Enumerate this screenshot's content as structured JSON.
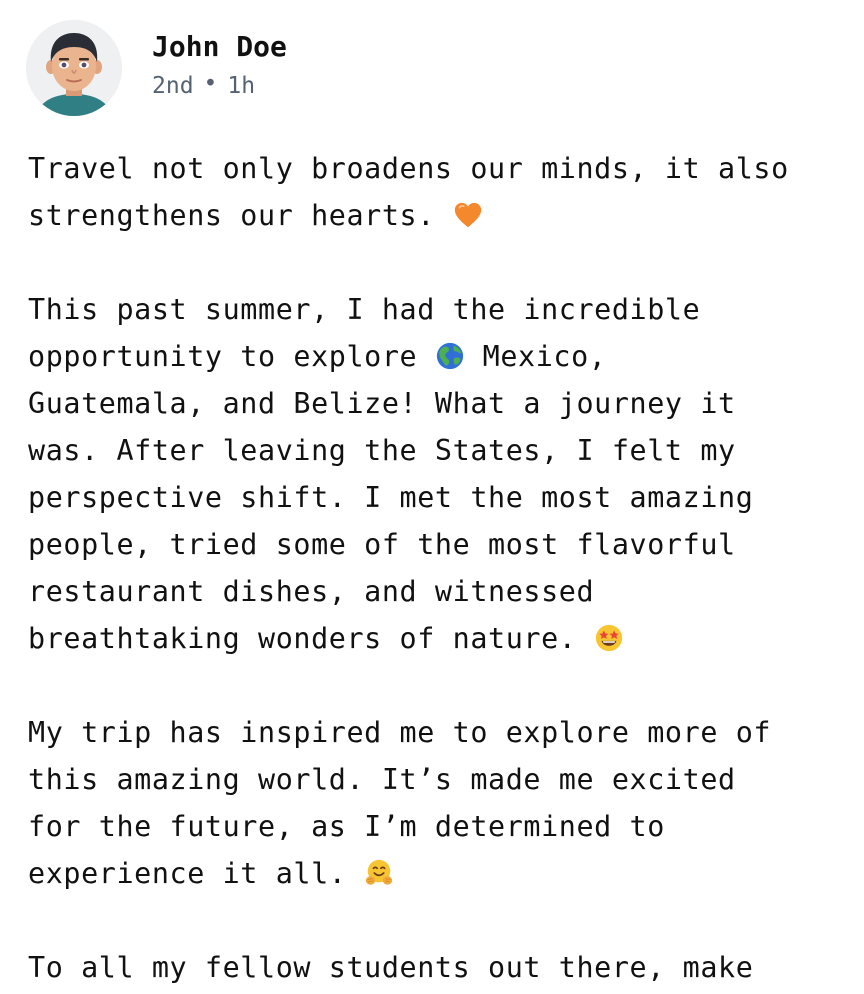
{
  "post": {
    "author": {
      "name": "John Doe",
      "avatar_icon": "man-avatar-icon",
      "connection_degree": "2nd",
      "separator": "•",
      "time_ago": "1h"
    },
    "paragraphs": [
      {
        "lines": [
          {
            "text": "Travel not only broadens our minds, it also"
          },
          {
            "text": "strengthens our hearts. ",
            "emoji": "orange-heart-icon"
          }
        ]
      },
      {
        "lines": [
          {
            "text": "This past summer, I had the incredible"
          },
          {
            "text": "opportunity to explore ",
            "emoji": "globe-americas-icon",
            "after": " Mexico,"
          },
          {
            "text": "Guatemala, and Belize! What a journey it"
          },
          {
            "text": "was. After leaving the States, I felt my"
          },
          {
            "text": "perspective shift. I met the most amazing"
          },
          {
            "text": "people, tried some of the most flavorful"
          },
          {
            "text": "restaurant dishes, and witnessed"
          },
          {
            "text": "breathtaking wonders of nature. ",
            "emoji": "star-struck-icon"
          }
        ]
      },
      {
        "lines": [
          {
            "text": "My trip has inspired me to explore more of"
          },
          {
            "text": "this amazing world. It’s made me excited"
          },
          {
            "text": "for the future, as I’m determined to"
          },
          {
            "text": "experience it all. ",
            "emoji": "hugging-face-icon"
          }
        ]
      },
      {
        "lines": [
          {
            "text": "To all my fellow students out there, make"
          }
        ]
      }
    ]
  },
  "colors": {
    "text": "#111111",
    "meta": "#566272",
    "heart": "#f4882c",
    "globe_water": "#2f6fd6",
    "globe_land": "#4caf50",
    "emoji_face": "#f7c531"
  }
}
